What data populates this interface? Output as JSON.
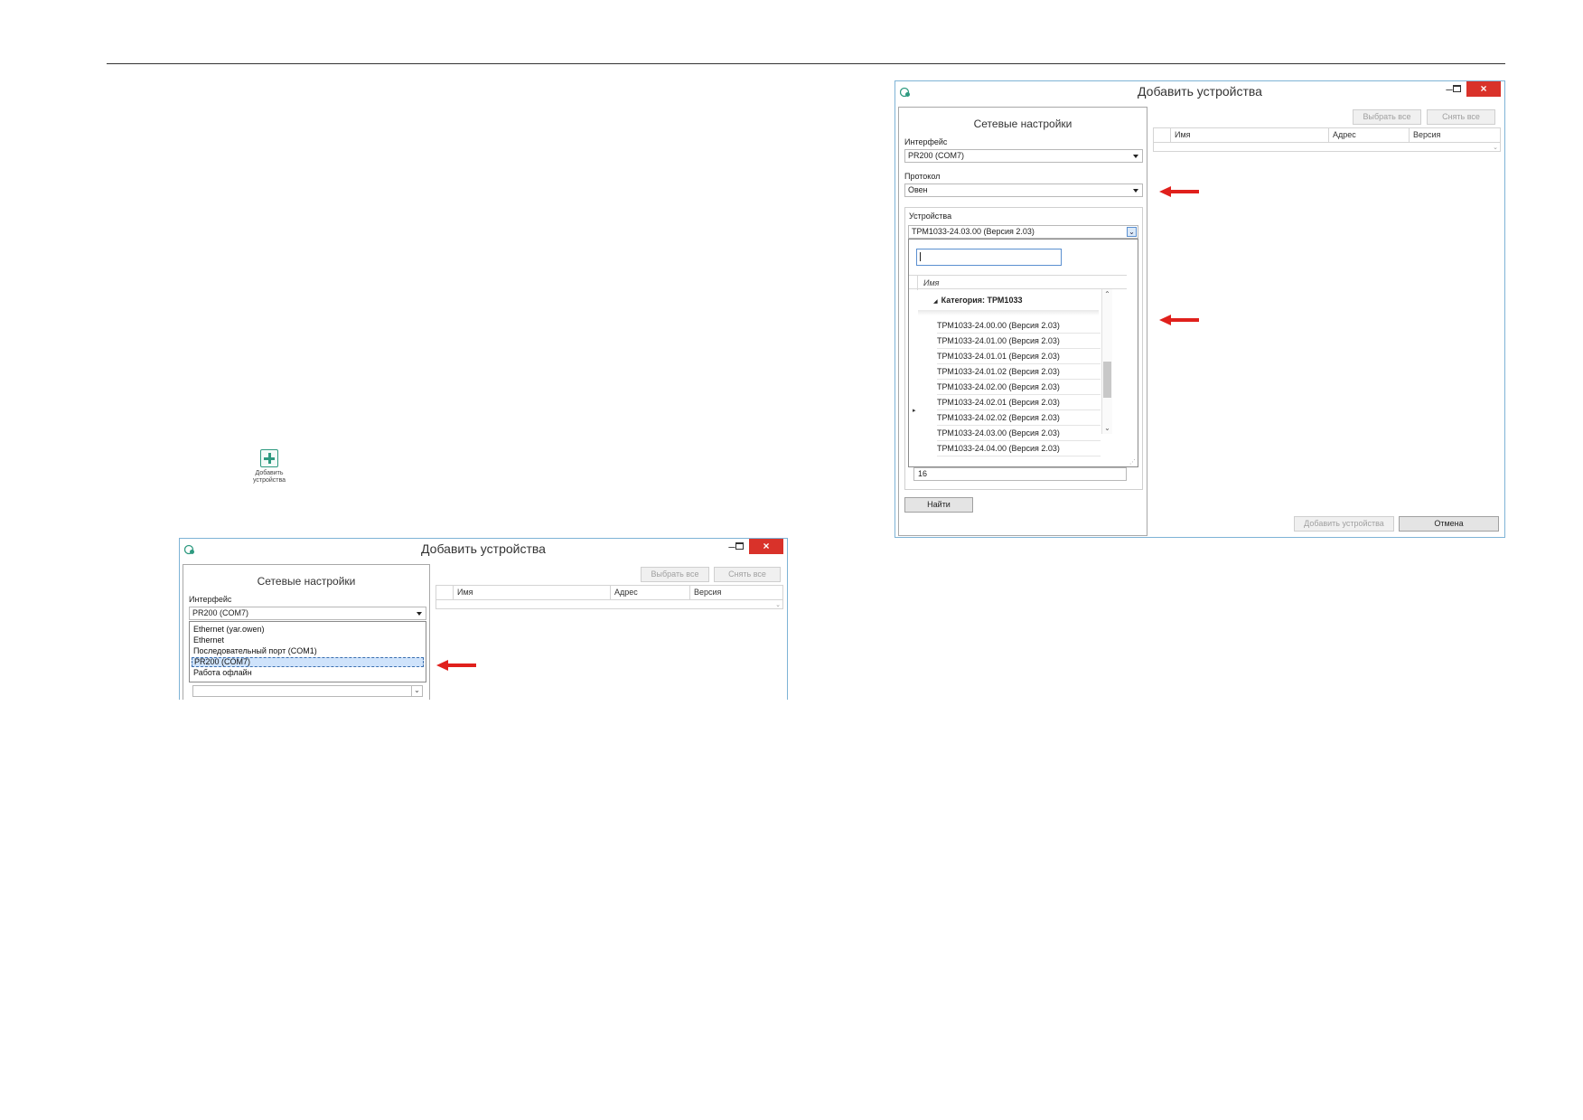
{
  "page": {
    "add_icon_caption": "Добавить\nустройства"
  },
  "dialog1": {
    "title": "Добавить устройства",
    "network_title": "Сетевые настройки",
    "interface_label": "Интерфейс",
    "interface_value": "PR200 (COM7)",
    "interface_options": [
      "Ethernet (yar.owen)",
      "Ethernet",
      "Последовательный порт (COM1)",
      "PR200 (COM7)",
      "Работа офлайн"
    ],
    "select_all": "Выбрать все",
    "deselect_all": "Снять все",
    "columns": [
      "Имя",
      "Адрес",
      "Версия"
    ]
  },
  "dialog2": {
    "title": "Добавить устройства",
    "network_title": "Сетевые настройки",
    "interface_label": "Интерфейс",
    "interface_value": "PR200 (COM7)",
    "protocol_label": "Протокол",
    "protocol_value": "Овен",
    "devices_label": "Устройства",
    "device_value": "ТРМ1033-24.03.00 (Версия 2.03)",
    "tree_header": "Имя",
    "category": "Категория: ТРМ1033",
    "devices": [
      "ТРМ1033-24.00.00 (Версия 2.03)",
      "ТРМ1033-24.01.00 (Версия 2.03)",
      "ТРМ1033-24.01.01 (Версия 2.03)",
      "ТРМ1033-24.01.02 (Версия 2.03)",
      "ТРМ1033-24.02.00 (Версия 2.03)",
      "ТРМ1033-24.02.01 (Версия 2.03)",
      "ТРМ1033-24.02.02 (Версия 2.03)",
      "ТРМ1033-24.03.00 (Версия 2.03)",
      "ТРМ1033-24.04.00 (Версия 2.03)"
    ],
    "address_value": "16",
    "find_button": "Найти",
    "select_all": "Выбрать все",
    "deselect_all": "Снять все",
    "columns": [
      "Имя",
      "Адрес",
      "Версия"
    ],
    "add_devices_button": "Добавить устройства",
    "cancel_button": "Отмена"
  },
  "icons": {
    "minimize": "–",
    "close": "×",
    "expander_down": "◢",
    "row_pointer": "▸",
    "scroll_up": "⌃",
    "scroll_down": "⌄"
  },
  "colors": {
    "accent_arrow": "#e0201c",
    "close_button": "#d9322a",
    "selection": "#cfe3fb",
    "icon_teal": "#2e9a80"
  }
}
